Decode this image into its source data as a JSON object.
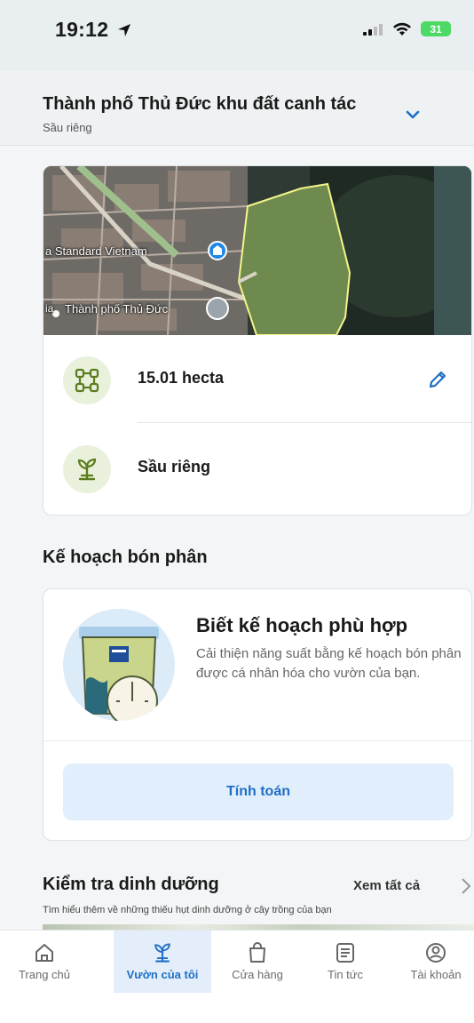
{
  "status_bar": {
    "time": "19:12",
    "battery": "31"
  },
  "header": {
    "title": "Thành phố Thủ Đức khu đất canh tác",
    "subtitle": "Sầu riêng"
  },
  "field": {
    "map_labels": {
      "place": "a Standard Vietnam",
      "city": "Thành phố Thủ Đức",
      "city_prefix": "ia"
    },
    "area": "15.01 hecta",
    "crop": "Sầu riêng"
  },
  "fertilizer": {
    "section_title": "Kế hoạch bón phân",
    "heading": "Biết kế hoạch phù hợp",
    "description": "Cải thiện năng suất bằng kế hoạch bón phân được cá nhân hóa cho vườn của bạn.",
    "button": "Tính toán"
  },
  "nutrition": {
    "title": "Kiểm tra dinh dưỡng",
    "see_all": "Xem tất cả",
    "subtitle": "Tìm hiểu thêm về những thiếu hụt dinh dưỡng ở cây trồng của bạn"
  },
  "tabs": [
    {
      "label": "Trang chủ",
      "icon": "home-icon"
    },
    {
      "label": "Vườn của tôi",
      "icon": "sprout-icon",
      "active": true
    },
    {
      "label": "Cửa hàng",
      "icon": "shopping-bag-icon"
    },
    {
      "label": "Tin tức",
      "icon": "news-icon"
    },
    {
      "label": "Tài khoản",
      "icon": "account-icon"
    }
  ],
  "colors": {
    "accent": "#1f6fc5",
    "field_outline": "#f3f58a",
    "icon_green": "#5a7d1e"
  }
}
